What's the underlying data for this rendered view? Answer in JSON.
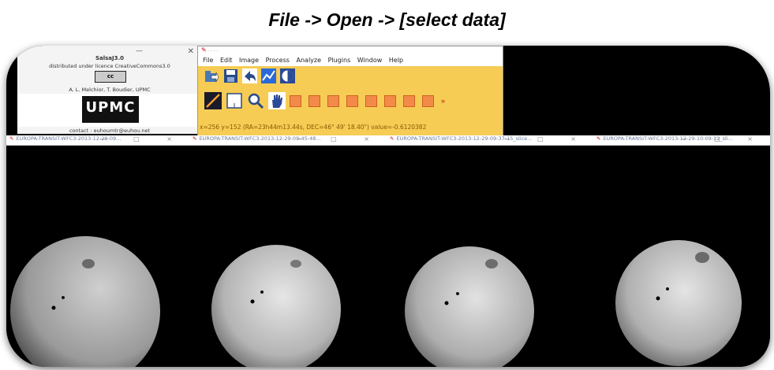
{
  "caption": "File -> Open -> [select data]",
  "about": {
    "title": "SalsaJ3.0",
    "license": "distributed under licence CreativeCommons3.0",
    "cc_badge": "cc",
    "authors": "A. L. Melchior, T. Boudier, UPMC",
    "logo": "UPMC",
    "contact": "contact : euhoumtr@euhou.net"
  },
  "main_window": {
    "menu": [
      "File",
      "Edit",
      "Image",
      "Process",
      "Analyze",
      "Plugins",
      "Window",
      "Help"
    ],
    "toolbar_row1": [
      "open-icon",
      "save-icon",
      "undo-icon",
      "graph-icon",
      "contrast-icon"
    ],
    "toolbar_row2": [
      "line-tool-icon",
      "rectangle-tool-icon",
      "magnifier-icon",
      "hand-icon",
      "plugin-icon",
      "plugin-icon",
      "plugin-icon",
      "plugin-icon",
      "plugin-icon",
      "plugin-icon",
      "plugin-icon",
      "plugin-icon"
    ],
    "more_label": "»",
    "status": "x=256 y=152 (RA=23h44m13.44s, DEC=46° 49' 18.40\") value=-0.6120382"
  },
  "image_windows": [
    {
      "title": "EUROPA-TRANSIT-WFC3-2013-12-29-09..."
    },
    {
      "title": "EUROPA-TRANSIT-WFC3-2013-12-29-09-45-48..."
    },
    {
      "title": "EUROPA-TRANSIT-WFC3-2013-12-29-09-37-15_slice..."
    },
    {
      "title": "EUROPA-TRANSIT-WFC3-2013-12-29-10-09-12_sli..."
    }
  ],
  "window_controls": "— □ ×",
  "colors": {
    "toolbar_bg": "#f6cc55",
    "plugin_button": "#f28a4a",
    "frame": "#000000"
  }
}
